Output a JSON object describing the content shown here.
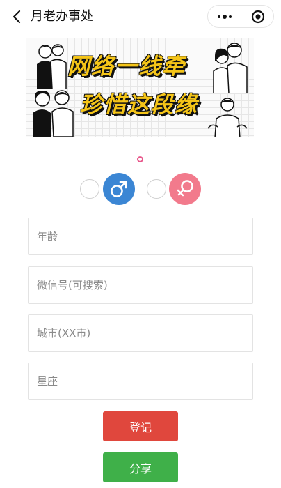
{
  "navbar": {
    "title": "月老办事处",
    "back_icon": "chevron-left-icon",
    "more_icon": "more-dots-icon",
    "close_icon": "target-close-icon"
  },
  "banner": {
    "line1": "网络一线牵",
    "line2": "珍惜这段缘",
    "text_color": "#f5c518"
  },
  "gender": {
    "male_symbol": "♂",
    "female_symbol": "♀",
    "male_color": "#3b86d4",
    "female_color": "#f27a8c",
    "indicator_color": "#e8578b"
  },
  "form": {
    "age_placeholder": "年龄",
    "wechat_placeholder": "微信号(可搜索)",
    "city_placeholder": "城市(XX市)",
    "constellation_placeholder": "星座"
  },
  "buttons": {
    "register_label": "登记",
    "share_label": "分享",
    "register_color": "#e0473d",
    "share_color": "#3fb049"
  }
}
